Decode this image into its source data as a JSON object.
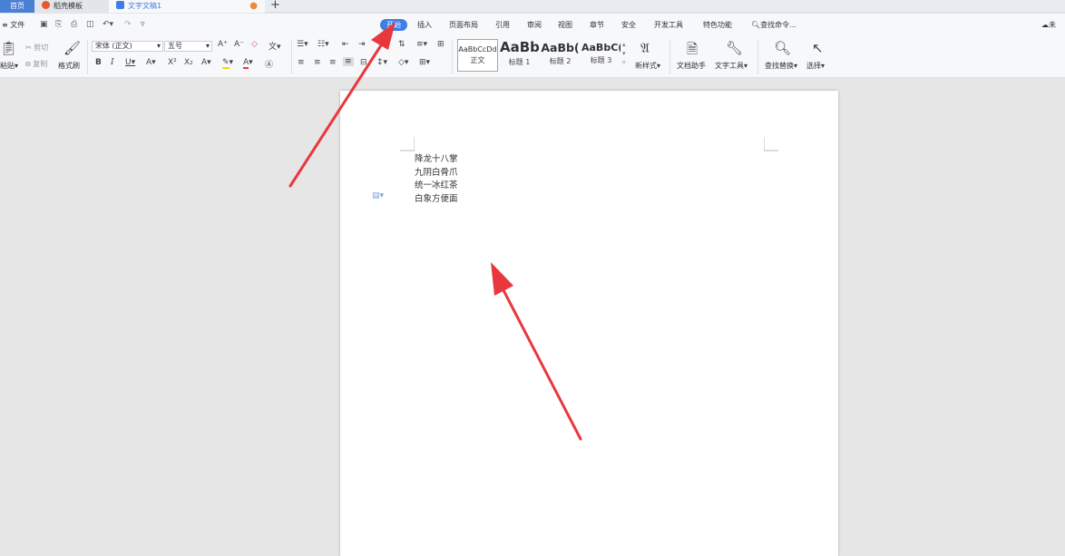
{
  "tabs": [
    {
      "label": "首页",
      "active": false
    },
    {
      "label": "稻壳模板",
      "active": false
    },
    {
      "label": "文字文稿1",
      "active": true
    }
  ],
  "new_tab_symbol": "+",
  "file_menu_label": "文件",
  "menu_items": [
    "开始",
    "插入",
    "页面布局",
    "引用",
    "审阅",
    "视图",
    "章节",
    "安全",
    "开发工具",
    "特色功能"
  ],
  "active_menu": "开始",
  "search_label": "查找命令...",
  "user_partial": "未",
  "ribbon": {
    "paste_label": "粘贴",
    "cut_label": "剪切",
    "copy_label": "复制",
    "format_painter_label": "格式刷",
    "font_name": "宋体 (正文)",
    "font_size": "五号",
    "styles": [
      {
        "sample": "AaBbCcDd",
        "caption": "正文"
      },
      {
        "sample": "AaBb",
        "caption": "标题 1"
      },
      {
        "sample": "AaBb(",
        "caption": "标题 2"
      },
      {
        "sample": "AaBbC(",
        "caption": "标题 3"
      }
    ],
    "new_style_label": "新样式",
    "doc_assistant_label": "文档助手",
    "text_tools_label": "文字工具",
    "find_replace_label": "查找替换",
    "select_label": "选择"
  },
  "document": {
    "lines": [
      "降龙十八掌",
      "九阴白骨爪",
      "统一冰红茶",
      "白象方便面"
    ]
  },
  "colors": {
    "accent": "#3d7ee8",
    "arrow": "#e8383d",
    "page": "#ffffff",
    "canvas": "#e6e6e6"
  }
}
